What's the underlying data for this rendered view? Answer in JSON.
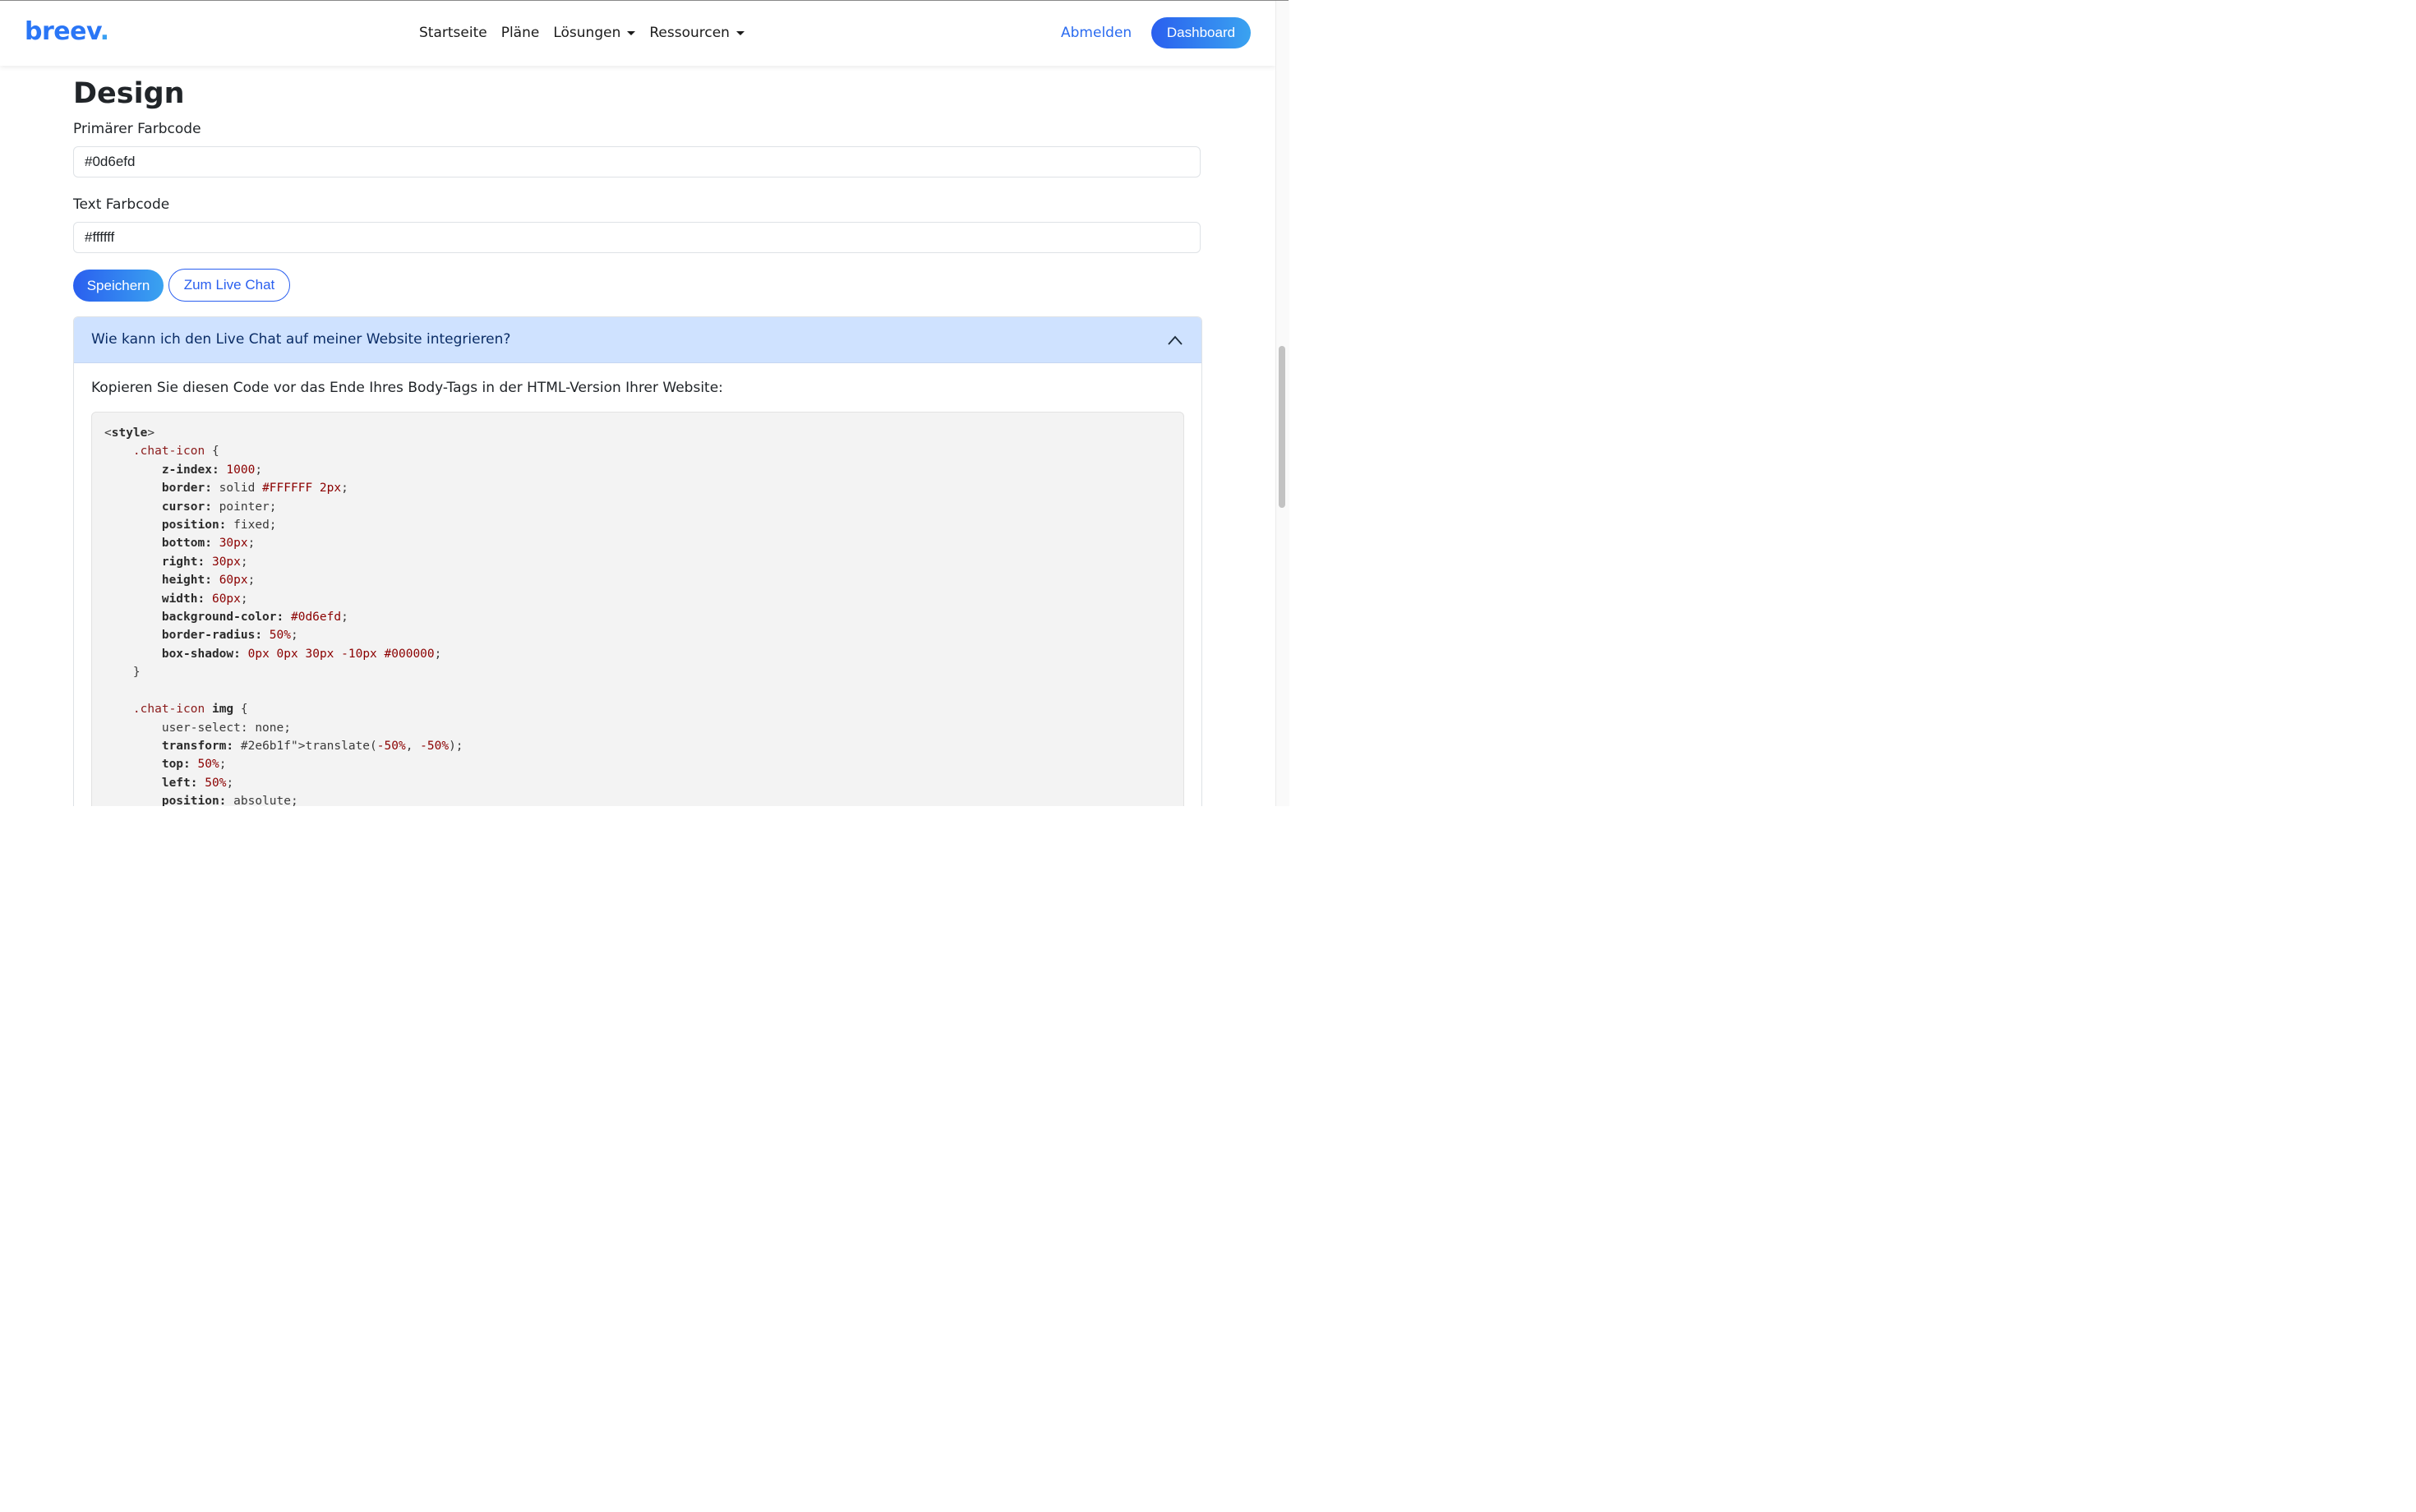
{
  "nav": {
    "brand_main": "breev",
    "brand_dot": ".",
    "items": [
      {
        "label": "Startseite",
        "dropdown": false
      },
      {
        "label": "Pläne",
        "dropdown": false
      },
      {
        "label": "Lösungen",
        "dropdown": true
      },
      {
        "label": "Ressourcen",
        "dropdown": true
      }
    ],
    "logout_label": "Abmelden",
    "dashboard_label": "Dashboard"
  },
  "design": {
    "title": "Design",
    "primary_label": "Primärer Farbcode",
    "primary_value": "#0d6efd",
    "text_label": "Text Farbcode",
    "text_value": "#ffffff",
    "save_label": "Speichern",
    "live_chat_label": "Zum Live Chat"
  },
  "accordion": {
    "question": "Wie kann ich den Live Chat auf meiner Website integrieren?",
    "expanded": true,
    "instruction": "Kopieren Sie diesen Code vor das Ende Ihres Body-Tags in der HTML-Version Ihrer Website:",
    "code_lines": [
      "<style>",
      "    .chat-icon {",
      "        z-index: 1000;",
      "        border: solid #FFFFFF 2px;",
      "        cursor: pointer;",
      "        position: fixed;",
      "        bottom: 30px;",
      "        right: 30px;",
      "        height: 60px;",
      "        width: 60px;",
      "        background-color: #0d6efd;",
      "        border-radius: 50%;",
      "        box-shadow: 0px 0px 30px -10px #000000;",
      "    }",
      "",
      "    .chat-icon img {",
      "        user-select: none;",
      "        transform: translate(-50%, -50%);",
      "        top: 50%;",
      "        left: 50%;",
      "        position: absolute;"
    ]
  },
  "colors": {
    "brand": "#2a76f6",
    "accent_gradient_start": "#2a5fef",
    "accent_gradient_end": "#3aa3f0",
    "accordion_header_bg": "#cfe2ff",
    "code_bg": "#f3f3f3",
    "code_property": "#2b2b2b",
    "code_number": "#8b0000",
    "code_function": "#2e6b1f",
    "code_selector": "#8a1a1a"
  },
  "icons": {
    "nav_caret": "caret-down-icon",
    "accordion_toggle": "chevron-up-icon"
  }
}
